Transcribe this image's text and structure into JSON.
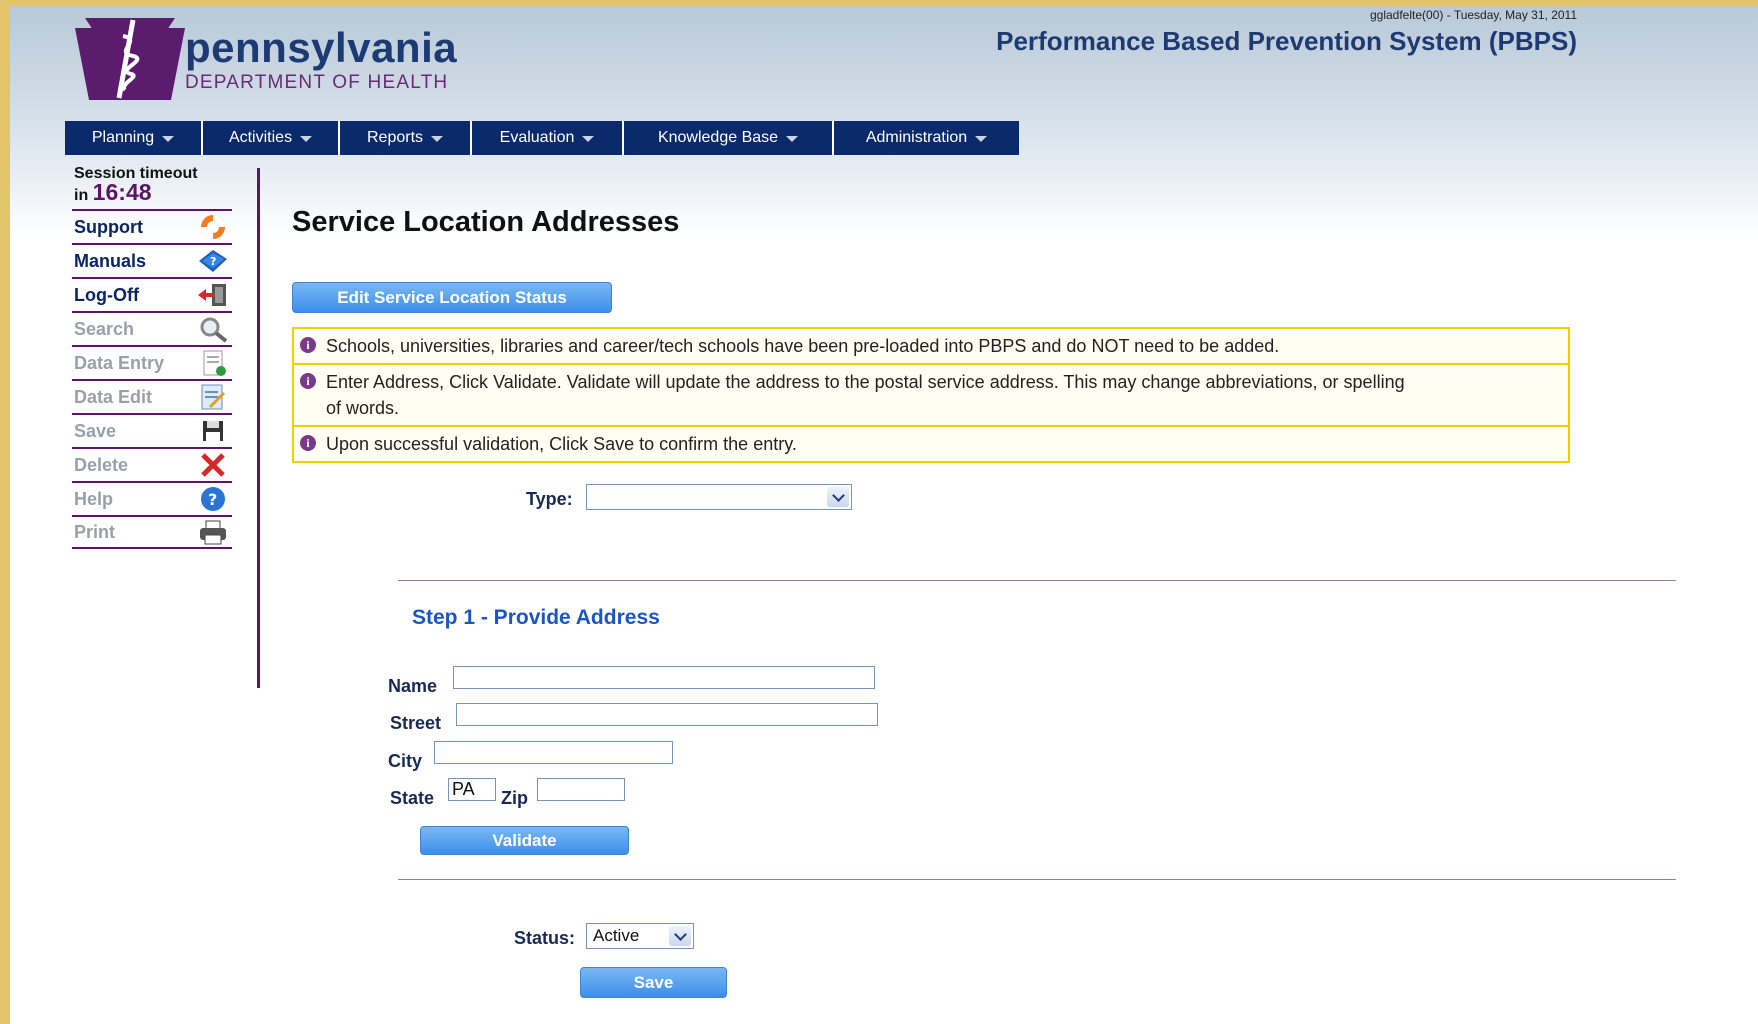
{
  "brand": {
    "name": "pennsylvania",
    "department": "DEPARTMENT OF HEALTH"
  },
  "header": {
    "user_info": "ggladfelte(00) - Tuesday, May 31, 2011",
    "app_title": "Performance Based Prevention System (PBPS)"
  },
  "nav": [
    {
      "label": "Planning"
    },
    {
      "label": "Activities"
    },
    {
      "label": "Reports"
    },
    {
      "label": "Evaluation"
    },
    {
      "label": "Knowledge Base"
    },
    {
      "label": "Administration"
    }
  ],
  "sidebar": {
    "session_label": "Session timeout",
    "session_in": "in",
    "session_minutes": "16",
    "session_sep": ":",
    "session_seconds": "48",
    "items": [
      {
        "label": "Support",
        "icon": "lifebuoy-icon",
        "enabled": true
      },
      {
        "label": "Manuals",
        "icon": "book-icon",
        "enabled": true
      },
      {
        "label": "Log-Off",
        "icon": "exit-door-icon",
        "enabled": true
      },
      {
        "label": "Search",
        "icon": "magnifier-icon",
        "enabled": false
      },
      {
        "label": "Data Entry",
        "icon": "form-add-icon",
        "enabled": false
      },
      {
        "label": "Data Edit",
        "icon": "form-edit-icon",
        "enabled": false
      },
      {
        "label": "Save",
        "icon": "floppy-disk-icon",
        "enabled": false
      },
      {
        "label": "Delete",
        "icon": "red-x-icon",
        "enabled": false
      },
      {
        "label": "Help",
        "icon": "question-circle-icon",
        "enabled": false
      },
      {
        "label": "Print",
        "icon": "printer-icon",
        "enabled": false
      }
    ]
  },
  "main": {
    "title": "Service Location Addresses",
    "edit_status_button": "Edit Service Location Status",
    "notes": [
      "Schools, universities, libraries and career/tech schools have been pre-loaded into PBPS and do NOT need to be added.",
      "Enter Address, Click Validate. Validate will update the address to the postal service address. This may change abbreviations, or spelling of words.",
      "Upon successful validation, Click Save to confirm the entry."
    ],
    "type_label": "Type:",
    "type_value": "",
    "step1_title": "Step 1 - Provide Address",
    "form": {
      "name_label": "Name",
      "name_value": "",
      "street_label": "Street",
      "street_value": "",
      "city_label": "City",
      "city_value": "",
      "state_label": "State",
      "state_value": "PA",
      "zip_label": "Zip",
      "zip_value": ""
    },
    "validate_button": "Validate",
    "status_label": "Status:",
    "status_value": "Active",
    "save_button": "Save"
  },
  "colors": {
    "nav_bg": "#0a2a6b",
    "brand_blue": "#1d3a73",
    "accent_purple": "#5c1566",
    "button_blue": "#3d8ee9",
    "note_border": "#f0d000",
    "step_title": "#1a56c7"
  }
}
